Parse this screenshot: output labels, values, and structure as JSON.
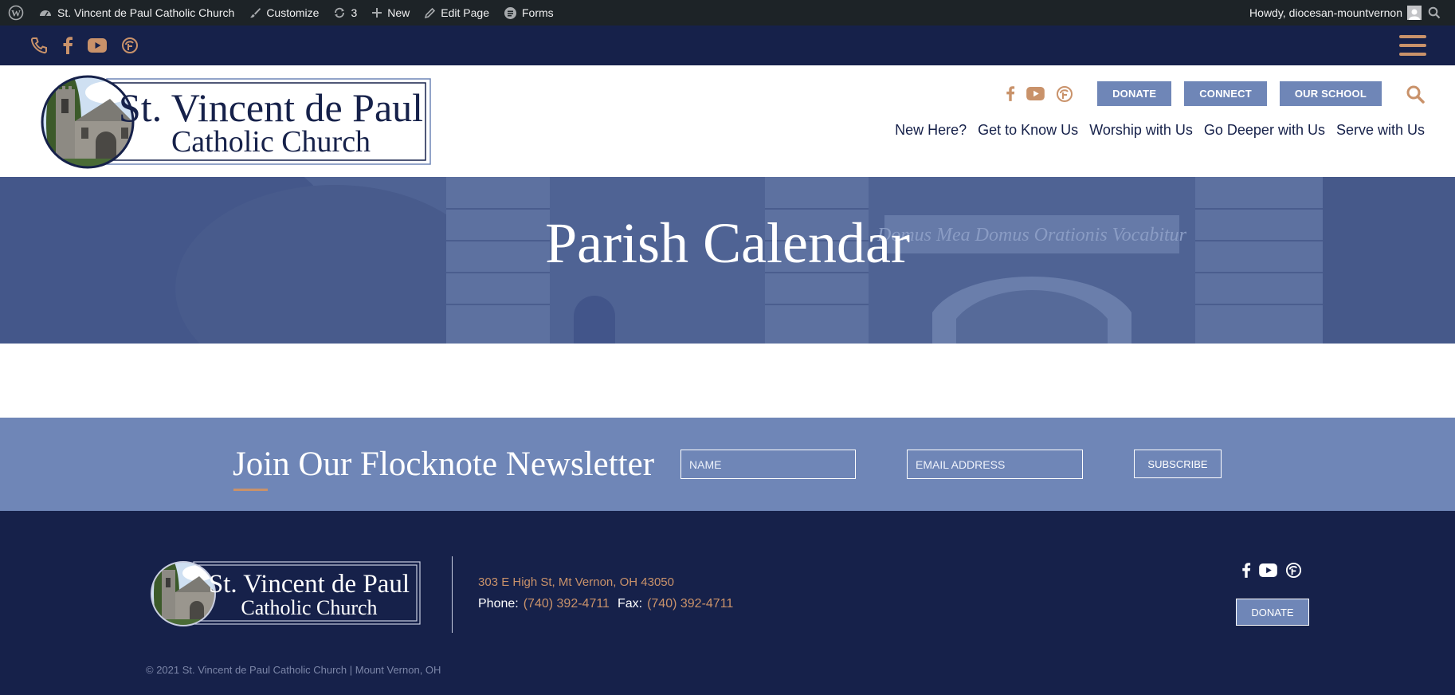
{
  "admin_bar": {
    "site_name": "St. Vincent de Paul Catholic Church",
    "customize": "Customize",
    "updates_count": "3",
    "new": "New",
    "edit_page": "Edit Page",
    "forms": "Forms",
    "greeting": "Howdy, diocesan-mountvernon"
  },
  "logo": {
    "line1": "St. Vincent de Paul",
    "line2": "Catholic Church"
  },
  "header": {
    "buttons": [
      "DONATE",
      "CONNECT",
      "OUR SCHOOL"
    ],
    "nav": [
      "New Here?",
      "Get to Know Us",
      "Worship with Us",
      "Go Deeper with Us",
      "Serve with Us"
    ]
  },
  "hero": {
    "title": "Parish Calendar",
    "inscription": "Domus Mea Domus Orationis Vocabitur"
  },
  "newsletter": {
    "title": "Join Our Flocknote Newsletter",
    "name_placeholder": "NAME",
    "email_placeholder": "EMAIL ADDRESS",
    "subscribe_label": "SUBSCRIBE"
  },
  "footer": {
    "address": "303 E High St, Mt Vernon, OH 43050",
    "phone_label": "Phone:",
    "phone": "(740) 392-4711",
    "fax_label": "Fax:",
    "fax": "(740) 392-4711",
    "donate_label": "DONATE",
    "copyright": "© 2021 St. Vincent de Paul Catholic Church | Mount Vernon, OH"
  },
  "colors": {
    "navy": "#16214a",
    "accent": "#c9926a",
    "periwinkle": "#6f86b7",
    "admin_bar": "#1d2327"
  },
  "icons": [
    "wordpress-icon",
    "dashboard-icon",
    "brush-icon",
    "refresh-icon",
    "plus-icon",
    "pencil-icon",
    "forms-icon",
    "phone-icon",
    "facebook-icon",
    "youtube-icon",
    "flocknote-icon",
    "hamburger-icon",
    "search-icon"
  ]
}
